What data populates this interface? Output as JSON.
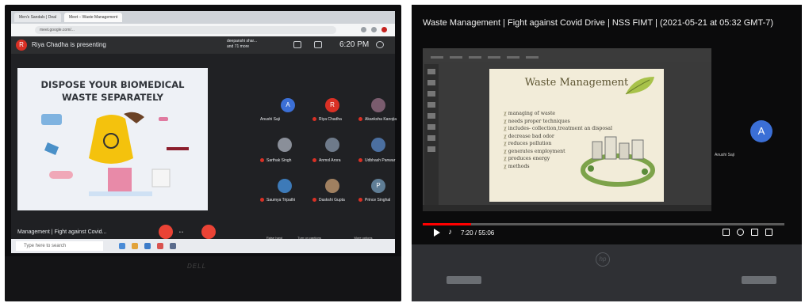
{
  "left_photo": {
    "browser": {
      "tabs": [
        "Men's Sandals | Deal",
        "Meet – Waste Management"
      ],
      "url": "meet.google.com/..."
    },
    "meet": {
      "presenter_initial": "R",
      "presenting_text": "Riya Chadha is presenting",
      "participant_chip": "deepanshi shar...\nand 71 more",
      "time": "6:20 PM",
      "slide": {
        "heading_line1": "DISPOSE YOUR BIOMEDICAL",
        "heading_line2": "WASTE SEPARATELY"
      },
      "participants": [
        {
          "name": "Anushi Saji",
          "initial": "A",
          "color": "#3b6fd6"
        },
        {
          "name": "Riya Chadha",
          "initial": "R",
          "color": "#d93025"
        },
        {
          "name": "Akanksha Kanojia",
          "initial": "",
          "color": "#7a5c6e"
        },
        {
          "name": "Sarthak Singh",
          "initial": "",
          "color": "#8a8f99"
        },
        {
          "name": "Anmol Arora",
          "initial": "",
          "color": "#6e7a8a"
        },
        {
          "name": "Udbhash Panwar",
          "initial": "",
          "color": "#4b6fa0"
        },
        {
          "name": "Saumya Tripathi",
          "initial": "",
          "color": "#3d7ab8"
        },
        {
          "name": "Daskshi Gupta",
          "initial": "",
          "color": "#a08060"
        },
        {
          "name": "Prince Singhal",
          "initial": "P",
          "color": "#5f7d95"
        }
      ],
      "meeting_title": "Management | Fight against Covid...",
      "controls": [
        "Raise hand",
        "Turn on captions",
        "More options"
      ]
    },
    "taskbar": {
      "search": "Type here to search"
    },
    "laptop_brand": "DELL"
  },
  "right_photo": {
    "video_title": "Waste Management | Fight against Covid Drive | NSS FIMT | (2021-05-21 at 05:32 GMT-7)",
    "slide_title": "Waste Management",
    "slide_bullets": [
      "managing of waste",
      "needs proper techniques",
      "includes- collection,treatment an disposal",
      "decrease bad odor",
      "reduces pollution",
      "generates employment",
      "produces energy",
      "methods"
    ],
    "participant_initial": "A",
    "participant_name": "Anushi Saji",
    "player_time": "7:20 / 55:06",
    "progress": 0.133,
    "laptop_brand": "hp"
  },
  "colors": {
    "meet_dark": "#202124",
    "accent_red": "#ea4335",
    "avatar_blue": "#3b6fd6",
    "youtube_red": "#ff0000"
  }
}
